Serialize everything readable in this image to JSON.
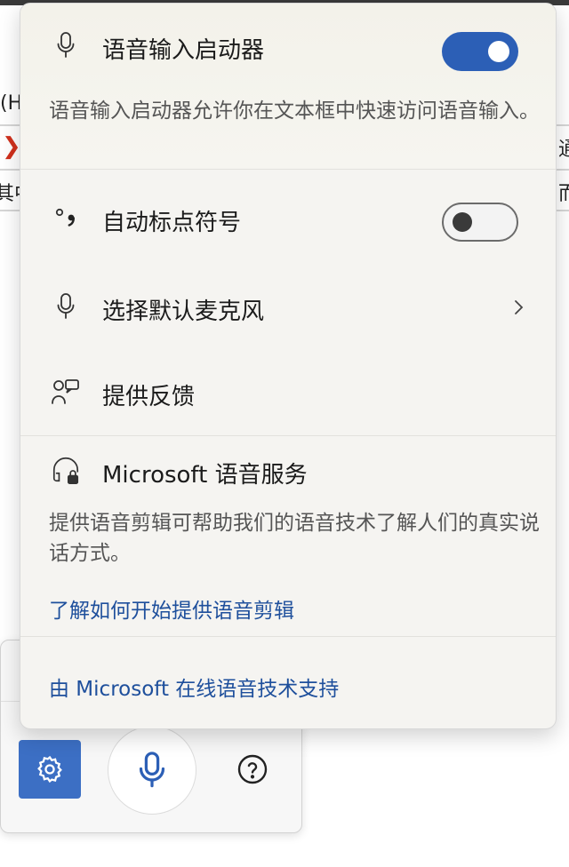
{
  "background_app": {
    "fragments": [
      "(H",
      "其中",
      "通",
      "而"
    ]
  },
  "flyout": {
    "launcher": {
      "label": "语音输入启动器",
      "enabled": true,
      "description": "语音输入启动器允许你在文本框中快速访问语音输入。",
      "icon": "microphone-icon"
    },
    "auto_punctuation": {
      "label": "自动标点符号",
      "enabled": false,
      "icon": "punctuation-icon"
    },
    "select_mic": {
      "label": "选择默认麦克风",
      "icon": "microphone-icon"
    },
    "feedback": {
      "label": "提供反馈",
      "icon": "feedback-icon"
    },
    "speech_service": {
      "label": "Microsoft 语音服务",
      "icon": "headset-lock-icon",
      "description": "提供语音剪辑可帮助我们的语音技术了解人们的真实说话方式。",
      "link": "了解如何开始提供语音剪辑"
    },
    "footer_link": "由 Microsoft 在线语音技术支持"
  },
  "voice_bar": {
    "settings_icon": "gear-icon",
    "mic_icon": "microphone-icon",
    "help_icon": "help-icon"
  },
  "colors": {
    "accent": "#2c5fb6",
    "link": "#1e4f9c",
    "settings_button": "#3c6fc4"
  }
}
